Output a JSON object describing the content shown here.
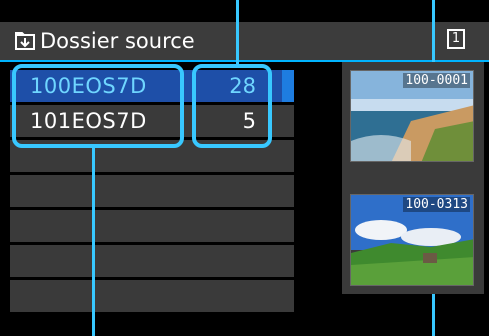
{
  "header": {
    "title": "Dossier source",
    "icon": "folder-select-icon",
    "card_slot": "1"
  },
  "folders": [
    {
      "name": "100EOS7D",
      "count": "28",
      "selected": true
    },
    {
      "name": "101EOS7D",
      "count": "5",
      "selected": false
    }
  ],
  "thumbnails": [
    {
      "file_number": "100-0001"
    },
    {
      "file_number": "100-0313"
    }
  ],
  "colors": {
    "accent": "#38c8ff",
    "selection": "#1e4fa8",
    "header": "#3c3c3c",
    "row": "#3a3a3a"
  }
}
